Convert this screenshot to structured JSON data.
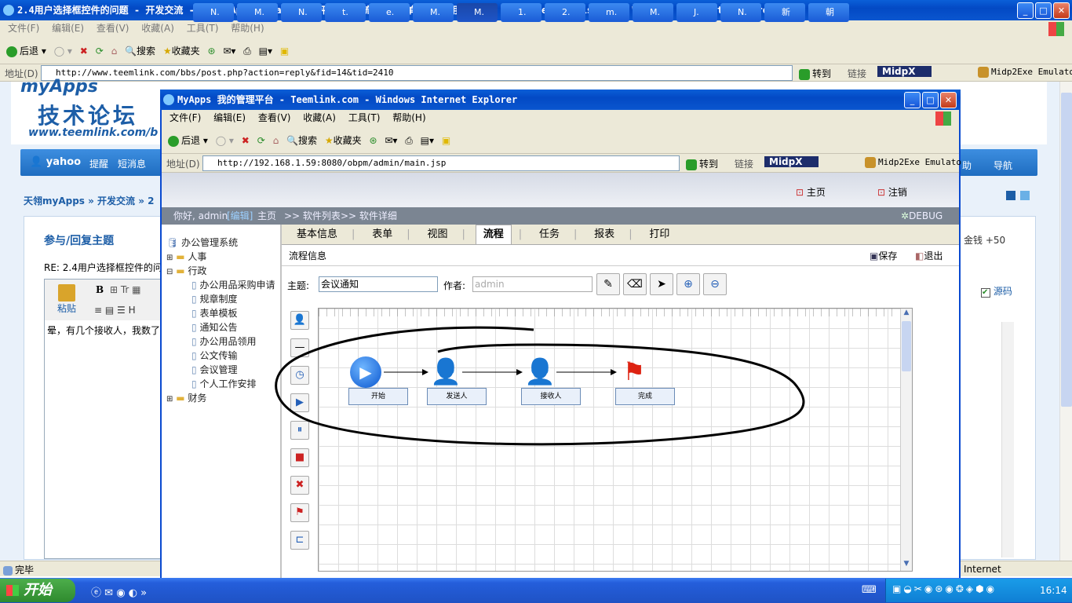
{
  "outer": {
    "title": "2.4用户选择框控件的问题 - 开发交流 - 天翎myApps java快速开发平台|工作流|智能表单|移动应用技术论坛 - Powered by Discuz! - Windows Internet Explorer",
    "menu": [
      "文件(F)",
      "编辑(E)",
      "查看(V)",
      "收藏(A)",
      "工具(T)",
      "帮助(H)"
    ],
    "toolbar": {
      "back": "后退",
      "search": "搜索",
      "favorites": "收藏夹"
    },
    "address_label": "地址(D)",
    "url": "http://www.teemlink.com/bbs/post.php?action=reply&fid=14&tid=2410",
    "go": "转到",
    "links": "链接",
    "midpx": "MidpX",
    "midp2exe": "Midp2Exe Emulato",
    "status": "完毕",
    "zone": "Internet"
  },
  "forum": {
    "logo_top": "myApps",
    "logo_main": "技术论坛",
    "logo_url": "www.teemlink.com/b",
    "nav_user": "yahoo",
    "nav_remind": "提醒",
    "nav_msg": "短消息",
    "nav_extra": "助",
    "nav_nav": "导航",
    "breadcrumb": "天翎myApps » 开发交流 » 2",
    "section_title": "参与/回复主题",
    "reply_subject": "RE: 2.4用户选择框控件的问",
    "paste": "粘贴",
    "body_text": "晕，有几个接收人，我数了",
    "coins": "金钱 +50",
    "source_code": "源码"
  },
  "inner": {
    "title": "MyApps 我的管理平台 - Teemlink.com - Windows Internet Explorer",
    "menu": [
      "文件(F)",
      "编辑(E)",
      "查看(V)",
      "收藏(A)",
      "工具(T)",
      "帮助(H)"
    ],
    "toolbar": {
      "back": "后退",
      "search": "搜索",
      "favorites": "收藏夹"
    },
    "address_label": "地址(D)",
    "url": "http://192.168.1.59:8080/obpm/admin/main.jsp",
    "go": "转到",
    "links": "链接",
    "midpx": "MidpX",
    "midp2exe": "Midp2Exe Emulato"
  },
  "app": {
    "home": "主页",
    "logout": "注销",
    "greeting": "你好, admin",
    "edit": "[编辑]",
    "crumb_home": "主页",
    "crumb_list": ">> 软件列表",
    "crumb_detail": ">> 软件详细",
    "debug": "DEBUG",
    "tree": {
      "root": "办公管理系统",
      "hr": "人事",
      "admin": "行政",
      "children": [
        "办公用品采购申请",
        "规章制度",
        "表单模板",
        "通知公告",
        "办公用品领用",
        "公文传输",
        "会议管理",
        "个人工作安排"
      ],
      "finance": "财务"
    },
    "tabs": [
      "基本信息",
      "表单",
      "视图",
      "流程",
      "任务",
      "报表",
      "打印"
    ],
    "active_tab": "流程",
    "section": "流程信息",
    "save": "保存",
    "exit": "退出",
    "subject_label": "主题:",
    "subject_value": "会议通知",
    "author_label": "作者:",
    "author_value": "admin",
    "nodes": [
      "开始",
      "发送人",
      "接收人",
      "完成"
    ]
  },
  "taskbar": {
    "start": "开始",
    "items": [
      "N.",
      "M.",
      "N.",
      "t.",
      "e.",
      "M.",
      "M.",
      "1.",
      "2.",
      "m.",
      "M.",
      "J.",
      "N.",
      "新",
      "朝"
    ],
    "clock": "16:14"
  },
  "colors": {
    "accent": "#0a56cf",
    "nav": "#2e7fd0",
    "taskbar": "#245edb"
  }
}
